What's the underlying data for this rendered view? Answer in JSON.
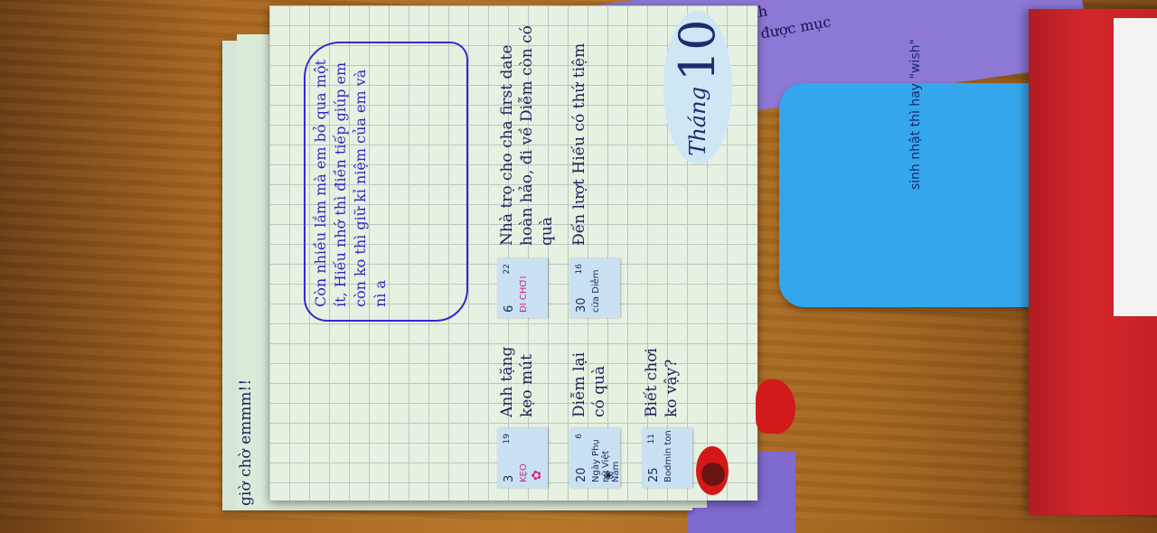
{
  "background_notes": {
    "purple_note_lines": [
      "n ảnh",
      "Đạt được mục"
    ],
    "blue_card_text": "sinh nhật thì hay \"wish\""
  },
  "card": {
    "month_word": "Tháng",
    "month_number": "10",
    "side_text": "giờ chờ emmm!!",
    "dates": [
      {
        "day": "3",
        "lunar": "19",
        "extra": "",
        "icon_label": "KẸO"
      },
      {
        "day": "6",
        "lunar": "22",
        "extra": "ĐI CHƠI",
        "icon_label": ""
      },
      {
        "day": "20",
        "lunar": "6",
        "extra": "Ngày Phụ nữ Việt Nam",
        "icon_label": ""
      },
      {
        "day": "30",
        "lunar": "16",
        "extra": "cửa Diễm",
        "icon_label": ""
      },
      {
        "day": "25",
        "lunar": "11",
        "extra": "Bodmin ton",
        "icon_label": ""
      }
    ],
    "entries": {
      "row1_a": "Anh tặng kẹo mút",
      "row1_b": "Nhà trọ cho cha first date hoàn hảo, đi về Diễm còn có quà",
      "row2_a": "Diễm lại có quà",
      "row2_b": "Đến lượt Hiếu có thứ tiệm",
      "row3_a": "Biết chơi ko vậy?",
      "row3_b": "Còn nhiều lắm mà em bỏ qua một ít, Hiếu nhớ thì điền tiếp giúp em còn ko thì giữ kỉ niệm của em và nì a"
    }
  }
}
